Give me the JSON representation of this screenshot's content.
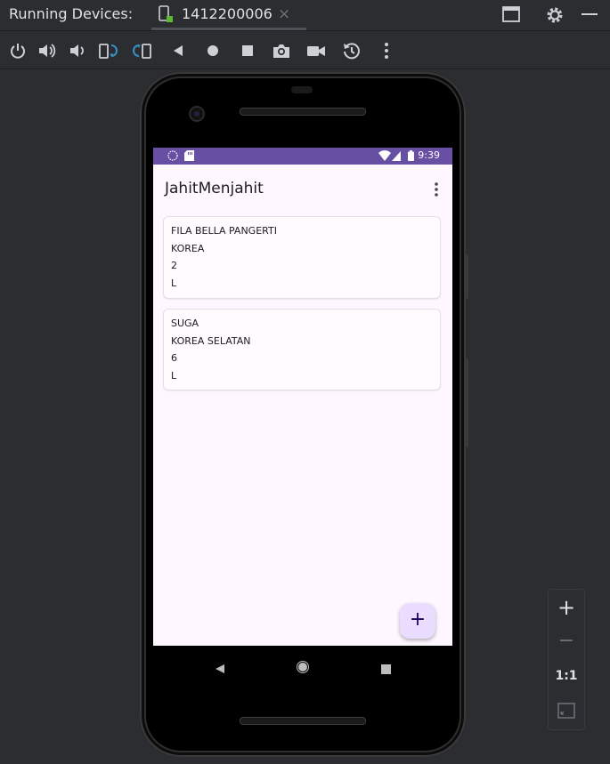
{
  "window": {
    "title": "Running Devices:",
    "tab_label": "1412200006",
    "tab_close": "×"
  },
  "toolbar_icons": [
    "power-icon",
    "volume-up-icon",
    "volume-down-icon",
    "rotate-left-icon",
    "rotate-right-icon",
    "back-icon",
    "home-icon",
    "overview-icon",
    "camera-icon",
    "video-icon",
    "snapshot-icon",
    "more-icon"
  ],
  "device": {
    "status_time": "9:39",
    "app_title": "JahitMenjahit",
    "cards": [
      {
        "lines": [
          "FILA BELLA PANGERTI",
          "KOREA",
          "2",
          "L"
        ]
      },
      {
        "lines": [
          "SUGA",
          "KOREA SELATAN",
          "6",
          "L"
        ]
      }
    ],
    "fab_label": "+"
  },
  "zoom": {
    "zoom_in": "+",
    "zoom_out": "−",
    "actual_size": "1:1"
  },
  "colors": {
    "status_bar": "#6750a4",
    "screen_bg": "#fef7ff",
    "fab_bg": "#eaddff",
    "ide_bg": "#2b2d30"
  }
}
